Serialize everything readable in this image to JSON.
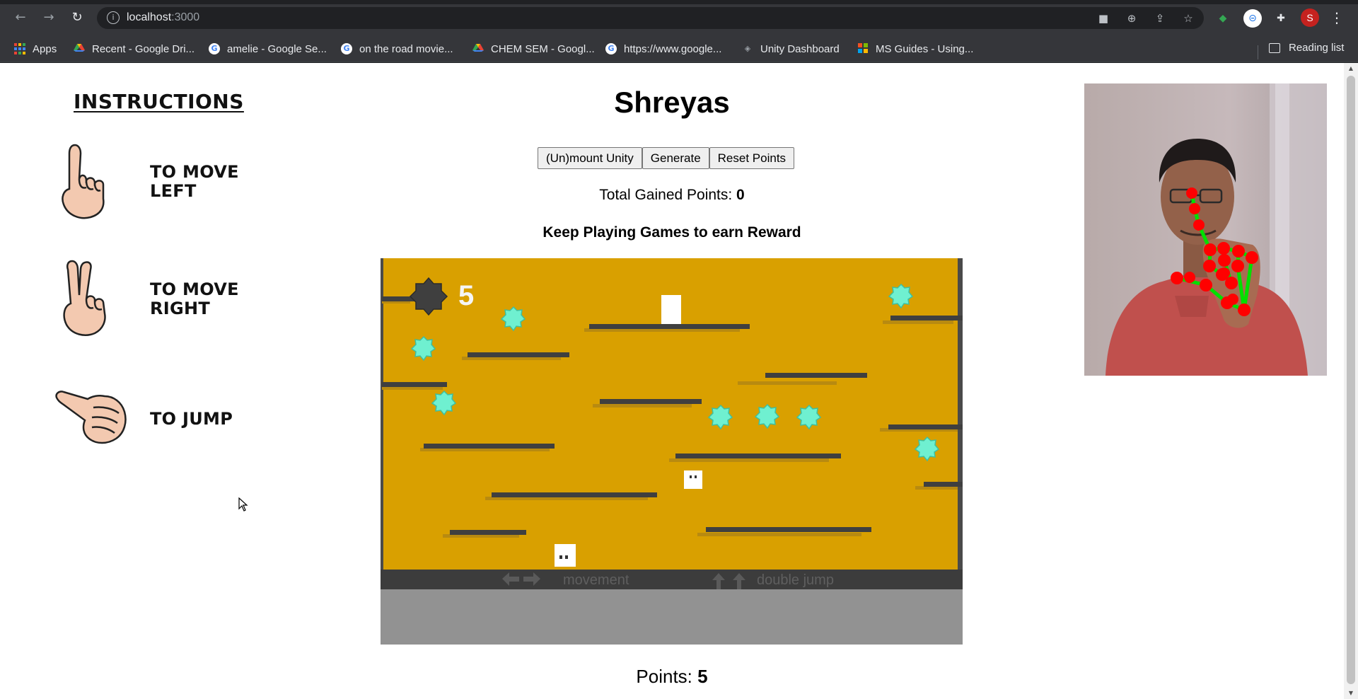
{
  "browser": {
    "url_host": "localhost",
    "url_port": ":3000",
    "bookmarks": [
      {
        "label": "Apps",
        "icon": "apps-grid-icon"
      },
      {
        "label": "Recent - Google Dri...",
        "icon": "google-drive-icon"
      },
      {
        "label": "amelie - Google Se...",
        "icon": "google-icon"
      },
      {
        "label": "on the road movie...",
        "icon": "google-icon"
      },
      {
        "label": "CHEM SEM - Googl...",
        "icon": "google-drive-icon"
      },
      {
        "label": "https://www.google...",
        "icon": "google-icon"
      },
      {
        "label": "Unity Dashboard",
        "icon": "unity-icon"
      },
      {
        "label": "MS Guides - Using...",
        "icon": "ms-guides-icon"
      }
    ],
    "reading_list": "Reading list",
    "profile_initial": "S"
  },
  "instructions": {
    "title": "INSTRUCTIONS",
    "items": [
      {
        "text_line1": "TO MOVE",
        "text_line2": "LEFT",
        "icon": "one-finger-hand-icon"
      },
      {
        "text_line1": "TO MOVE",
        "text_line2": "RIGHT",
        "icon": "two-finger-hand-icon"
      },
      {
        "text_line1": "TO JUMP",
        "text_line2": "",
        "icon": "thumb-hand-icon"
      }
    ]
  },
  "main": {
    "player_name": "Shreyas",
    "buttons": {
      "unmount": "(Un)mount Unity",
      "generate": "Generate",
      "reset": "Reset Points"
    },
    "total_label": "Total Gained Points: ",
    "total_value": "0",
    "keep_playing": "Keep Playing Games to earn Reward",
    "points_label": "Points: ",
    "points_value": "5"
  },
  "game": {
    "score": "5",
    "movement_hint": "movement",
    "jump_hint": "double jump",
    "colors": {
      "background": "#d9a000",
      "platform": "#3f3f3f",
      "gem": "#6ff0d0",
      "hud_bar": "#3c3c3c",
      "floor": "#929292"
    }
  },
  "colors": {
    "hand_landmark": "#ff0000",
    "hand_connection": "#00e000"
  }
}
